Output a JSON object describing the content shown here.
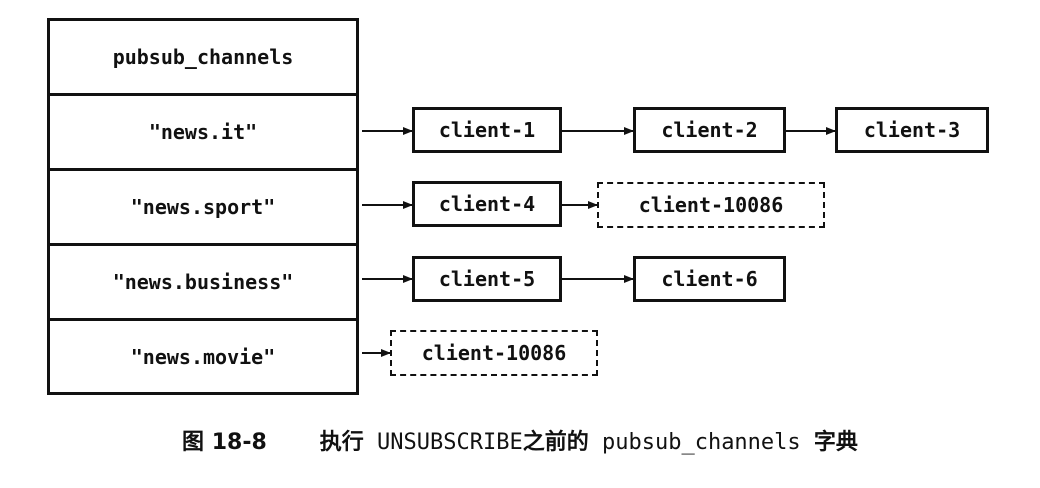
{
  "table": {
    "header": "pubsub_channels",
    "rows": [
      {
        "key": "\"news.it\"",
        "clients": [
          {
            "name": "client-1",
            "dashed": false
          },
          {
            "name": "client-2",
            "dashed": false
          },
          {
            "name": "client-3",
            "dashed": false
          }
        ]
      },
      {
        "key": "\"news.sport\"",
        "clients": [
          {
            "name": "client-4",
            "dashed": false
          },
          {
            "name": "client-10086",
            "dashed": true
          }
        ]
      },
      {
        "key": "\"news.business\"",
        "clients": [
          {
            "name": "client-5",
            "dashed": false
          },
          {
            "name": "client-6",
            "dashed": false
          }
        ]
      },
      {
        "key": "\"news.movie\"",
        "clients": [
          {
            "name": "client-10086",
            "dashed": true
          }
        ]
      }
    ]
  },
  "caption": {
    "figure": "图 18-8",
    "text_before": "执行",
    "command": "UNSUBSCRIBE",
    "text_middle": "之前的",
    "dict_name": "pubsub_channels",
    "text_after": "字典"
  }
}
